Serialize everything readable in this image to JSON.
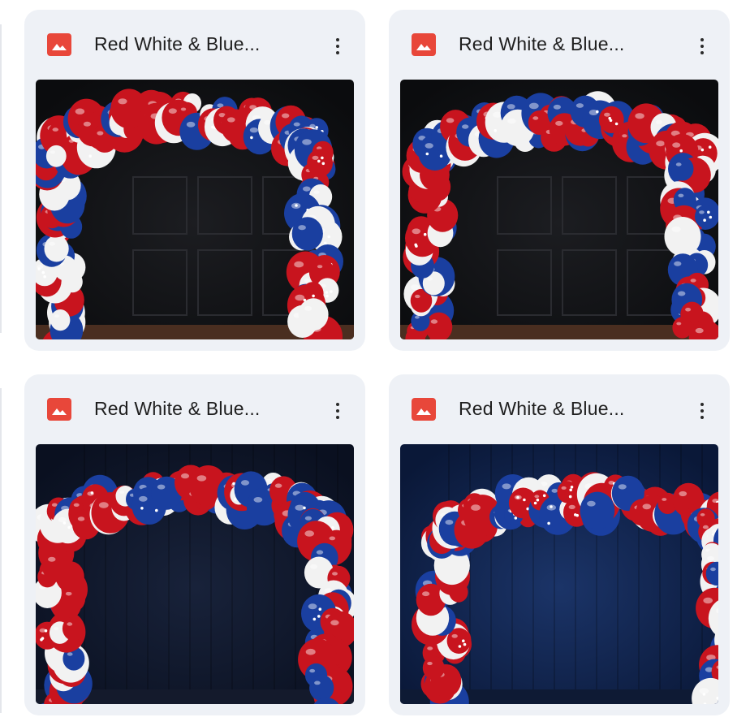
{
  "files": [
    {
      "title": "Red White & Blue...",
      "type_icon": "image-file-icon",
      "menu_icon": "more-vert-icon",
      "backdrop": "black-panel-wall"
    },
    {
      "title": "Red White & Blue...",
      "type_icon": "image-file-icon",
      "menu_icon": "more-vert-icon",
      "backdrop": "black-panel-wall"
    },
    {
      "title": "Red White & Blue...",
      "type_icon": "image-file-icon",
      "menu_icon": "more-vert-icon",
      "backdrop": "navy-wall"
    },
    {
      "title": "Red White & Blue...",
      "type_icon": "image-file-icon",
      "menu_icon": "more-vert-icon",
      "backdrop": "blue-wall"
    }
  ],
  "colors": {
    "card_bg": "#eef1f6",
    "icon_red": "#e8473a",
    "title_text": "#1f1f1f",
    "balloon_red": "#c8141e",
    "balloon_white": "#f2f2f2",
    "balloon_blue": "#1a3fa0"
  }
}
